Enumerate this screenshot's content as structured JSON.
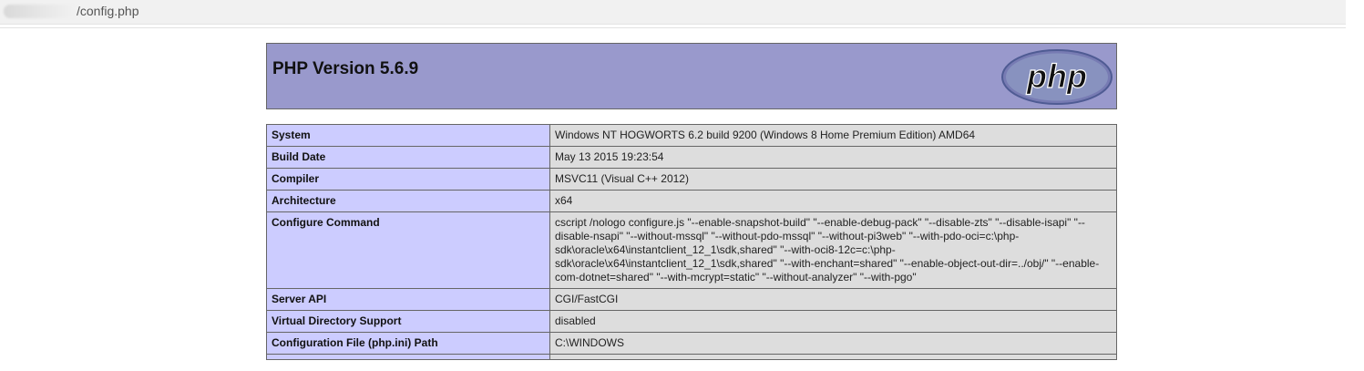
{
  "browser": {
    "url_suffix": "/config.php"
  },
  "header": {
    "title": "PHP Version 5.6.9",
    "logo_text": "php"
  },
  "rows": [
    {
      "label": "System",
      "value": "Windows NT HOGWORTS 6.2 build 9200 (Windows 8 Home Premium Edition) AMD64"
    },
    {
      "label": "Build Date",
      "value": "May 13 2015 19:23:54"
    },
    {
      "label": "Compiler",
      "value": "MSVC11 (Visual C++ 2012)"
    },
    {
      "label": "Architecture",
      "value": "x64"
    },
    {
      "label": "Configure Command",
      "value": "cscript /nologo configure.js \"--enable-snapshot-build\" \"--enable-debug-pack\" \"--disable-zts\" \"--disable-isapi\" \"--disable-nsapi\" \"--without-mssql\" \"--without-pdo-mssql\" \"--without-pi3web\" \"--with-pdo-oci=c:\\php-sdk\\oracle\\x64\\instantclient_12_1\\sdk,shared\" \"--with-oci8-12c=c:\\php-sdk\\oracle\\x64\\instantclient_12_1\\sdk,shared\" \"--with-enchant=shared\" \"--enable-object-out-dir=../obj/\" \"--enable-com-dotnet=shared\" \"--with-mcrypt=static\" \"--without-analyzer\" \"--with-pgo\""
    },
    {
      "label": "Server API",
      "value": "CGI/FastCGI"
    },
    {
      "label": "Virtual Directory Support",
      "value": "disabled"
    },
    {
      "label": "Configuration File (php.ini) Path",
      "value": "C:\\WINDOWS"
    },
    {
      "label": "",
      "value": ""
    }
  ],
  "colors": {
    "header_bg": "#9999cc",
    "label_bg": "#ccccff",
    "value_bg": "#dddddd",
    "border": "#666666"
  }
}
